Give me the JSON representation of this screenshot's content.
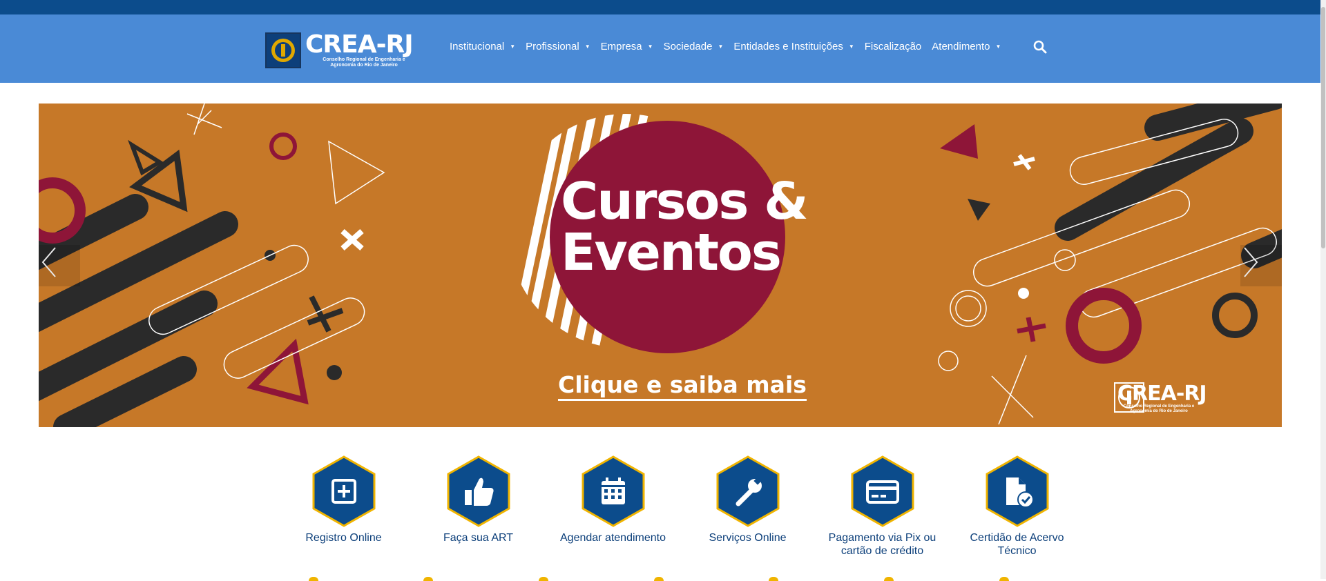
{
  "header": {
    "logo": {
      "name": "CREA-RJ",
      "subtitle": "Conselho Regional de Engenharia e Agronomia do Rio de Janeiro"
    },
    "nav": [
      {
        "label": "Institucional",
        "has_dropdown": true
      },
      {
        "label": "Profissional",
        "has_dropdown": true
      },
      {
        "label": "Empresa",
        "has_dropdown": true
      },
      {
        "label": "Sociedade",
        "has_dropdown": true
      },
      {
        "label": "Entidades e Instituições",
        "has_dropdown": true
      },
      {
        "label": "Fiscalização",
        "has_dropdown": false
      },
      {
        "label": "Atendimento",
        "has_dropdown": true
      }
    ],
    "search_icon": "search-icon",
    "caret_glyph": "▼"
  },
  "banner": {
    "title_line1": "Cursos &",
    "title_line2": "Eventos",
    "cta": "Clique e saiba mais",
    "logo_name": "CREA-RJ",
    "logo_subtitle": "Conselho Regional de Engenharia e Agronomia do Rio de Janeiro",
    "prev_icon": "chevron-left-icon",
    "next_icon": "chevron-right-icon"
  },
  "shortcuts": [
    {
      "label": "Registro Online",
      "icon": "plus-square-icon"
    },
    {
      "label": "Faça sua ART",
      "icon": "thumbs-up-icon"
    },
    {
      "label": "Agendar atendimento",
      "icon": "calendar-icon"
    },
    {
      "label": "Serviços Online",
      "icon": "wrench-icon"
    },
    {
      "label": "Pagamento via Pix ou cartão de crédito",
      "icon": "credit-card-icon"
    },
    {
      "label": "Certidão de Acervo Técnico",
      "icon": "file-check-icon"
    }
  ],
  "colors": {
    "topbar": "#0c4c8c",
    "navbar": "#4a8ad6",
    "banner_bg": "#c67828",
    "banner_circle": "#8e1538",
    "hex_fill": "#0c4c8c",
    "hex_border": "#f0b400",
    "label": "#0c3f7a"
  }
}
